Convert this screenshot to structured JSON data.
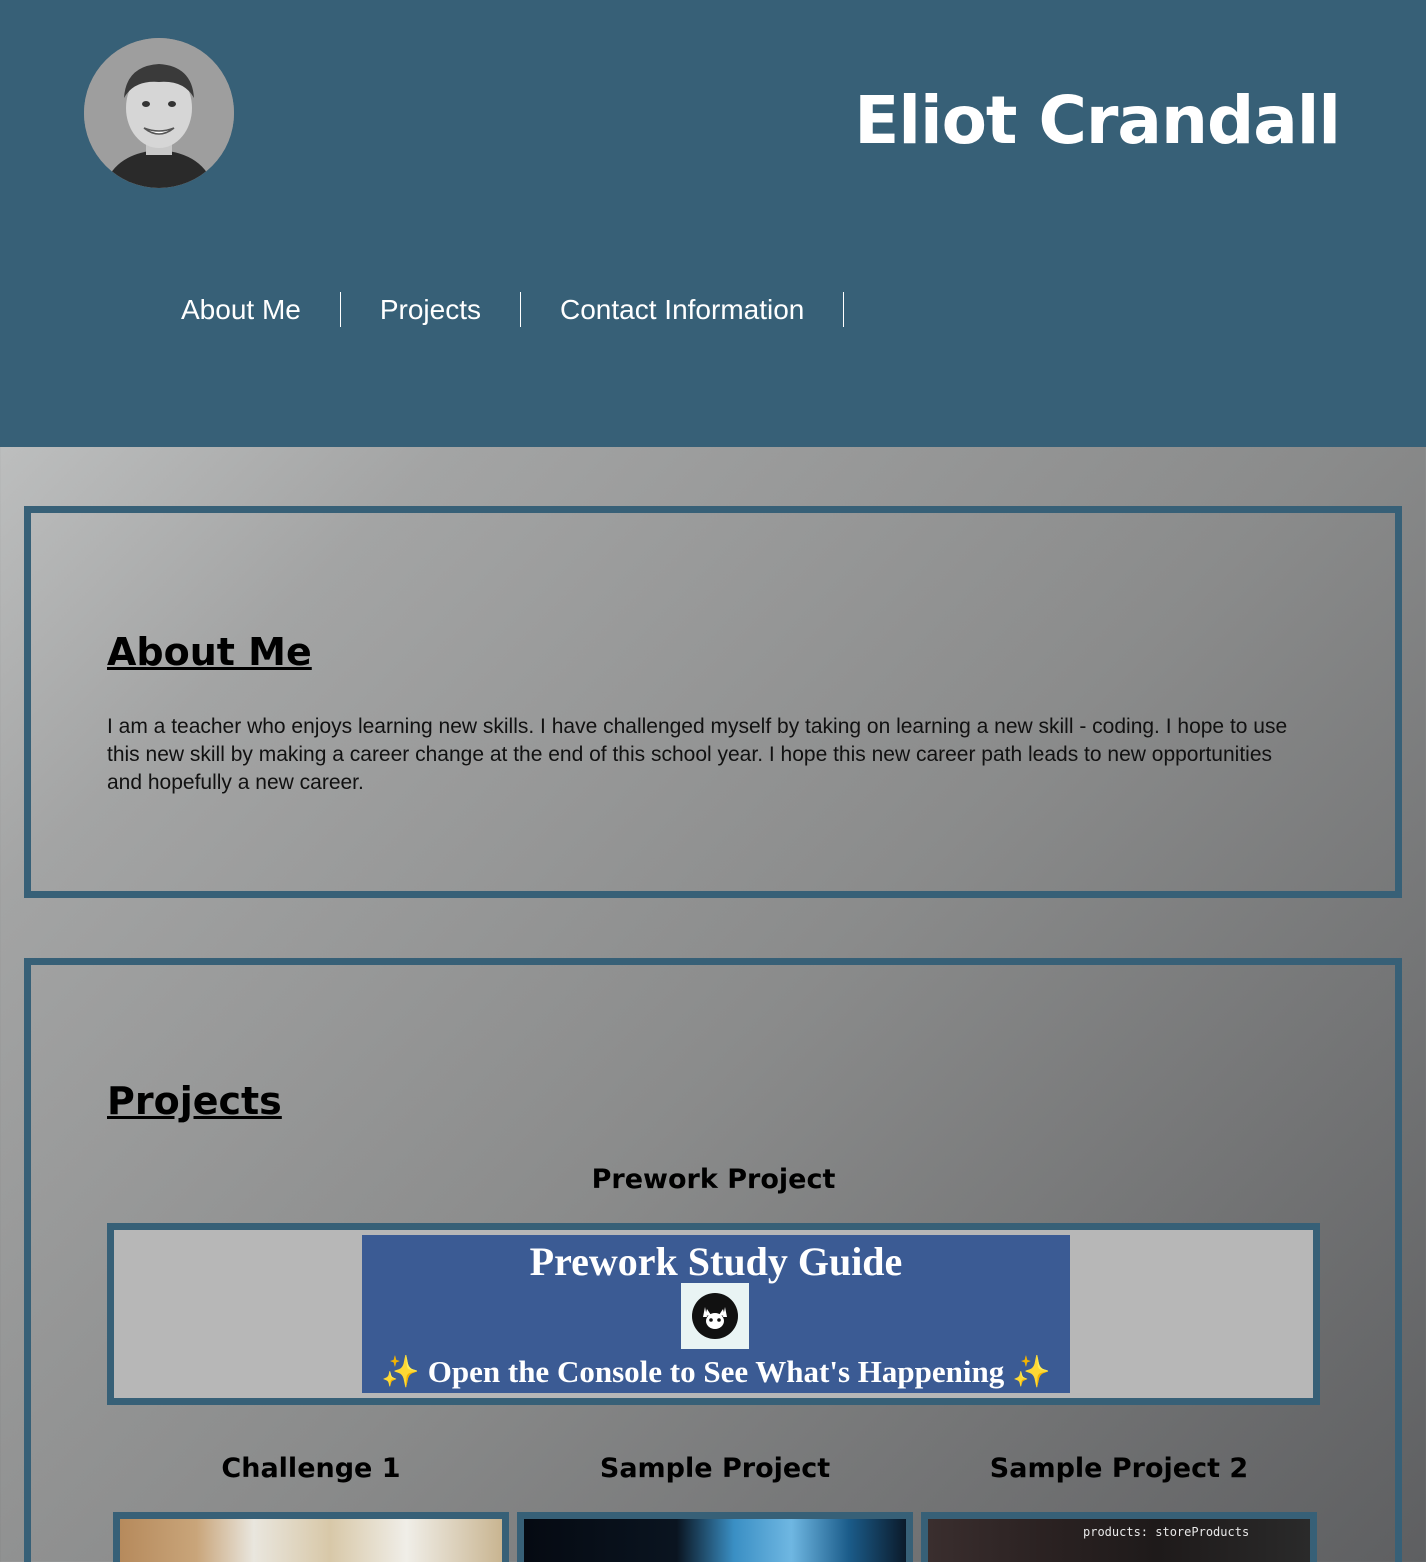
{
  "header": {
    "name": "Eliot Crandall",
    "nav": [
      "About Me",
      "Projects",
      "Contact Information"
    ]
  },
  "about": {
    "heading": "About Me",
    "text": "I am a teacher who enjoys learning new skills. I have challenged myself by taking on learning a new skill - coding. I hope to use this new skill by making a career change at the end of this school year. I hope this new career path leads to new opportunities and hopefully a new career."
  },
  "projects": {
    "heading": "Projects",
    "featured": {
      "title": "Prework Project",
      "image_title": "Prework Study Guide",
      "image_subtitle": "Open the Console to See What's Happening",
      "sparkle": "✨"
    },
    "items": [
      {
        "title": "Challenge 1"
      },
      {
        "title": "Sample Project"
      },
      {
        "title": "Sample Project 2",
        "snippet": "products: storeProducts"
      }
    ]
  },
  "colors": {
    "header_bg": "#376077",
    "border": "#376077",
    "study_guide_bg": "#3b5b94"
  }
}
